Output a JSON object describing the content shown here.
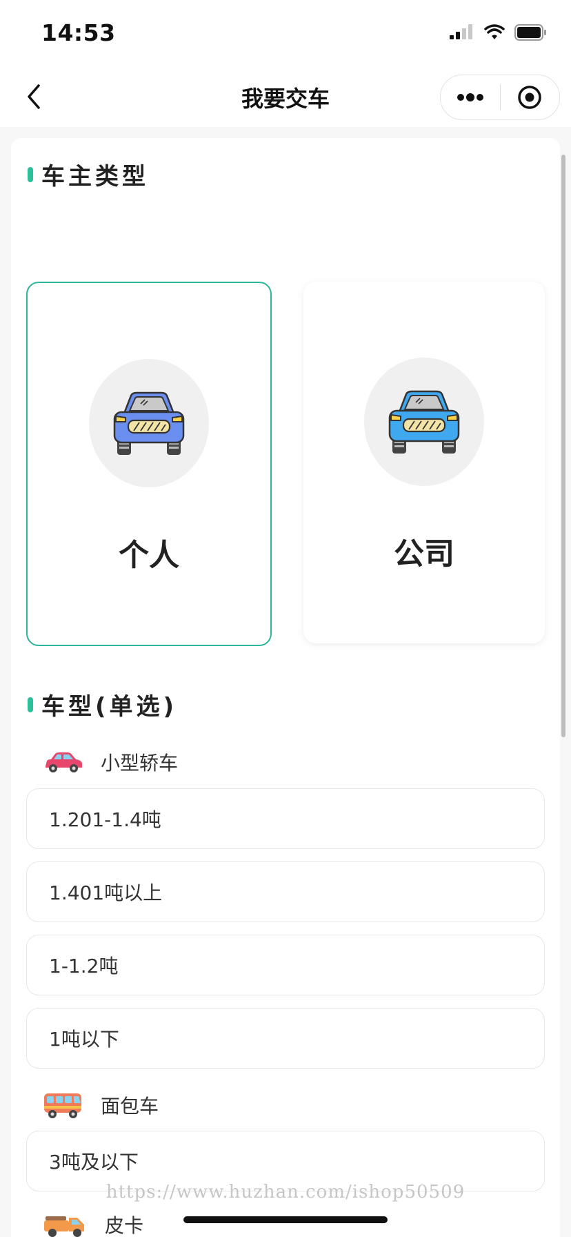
{
  "status_bar": {
    "time": "14:53"
  },
  "nav": {
    "title": "我要交车"
  },
  "owner_section": {
    "title": "车主类型",
    "options": [
      {
        "label": "个人",
        "selected": true
      },
      {
        "label": "公司",
        "selected": false
      }
    ]
  },
  "vehicle_section": {
    "title": "车型(单选)",
    "groups": [
      {
        "label": "小型轿车",
        "icon": "sedan-icon",
        "options": [
          "1.201-1.4吨",
          "1.401吨以上",
          "1-1.2吨",
          "1吨以下"
        ]
      },
      {
        "label": "面包车",
        "icon": "van-icon",
        "options": [
          "3吨及以下"
        ]
      },
      {
        "label": "皮卡",
        "icon": "pickup-icon",
        "options": []
      }
    ]
  },
  "watermark": "https://www.huzhan.com/ishop50509",
  "colors": {
    "accent": "#2bbf9a",
    "selected_border": "#2bb59a"
  }
}
